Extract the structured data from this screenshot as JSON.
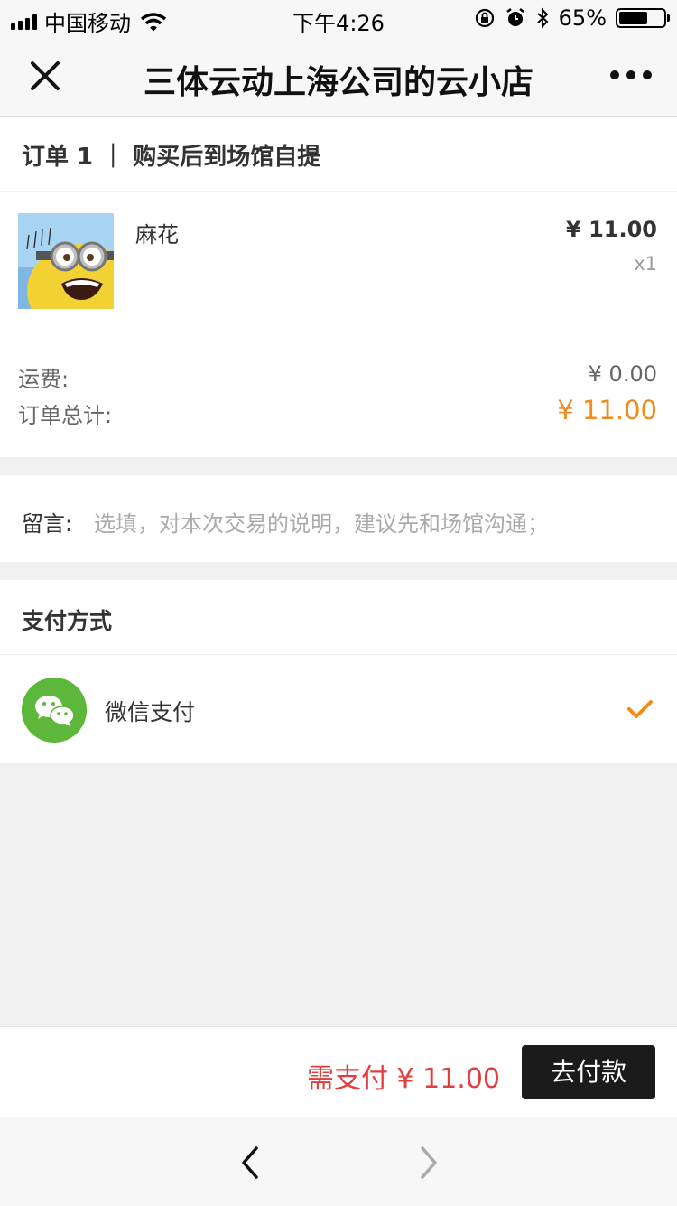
{
  "status_bar": {
    "carrier": "中国移动",
    "time": "下午4:26",
    "battery_percent": "65%",
    "battery_level": 0.65
  },
  "nav": {
    "title": "三体云动上海公司的云小店"
  },
  "order": {
    "header": "订单 1 ｜ 购买后到场馆自提",
    "product": {
      "name": "麻花",
      "price": "¥ 11.00",
      "quantity": "x1"
    },
    "shipping_label": "运费:",
    "shipping_value": "¥ 0.00",
    "total_label": "订单总计:",
    "total_value": "¥ 11.00"
  },
  "message": {
    "label": "留言:",
    "placeholder": "选填，对本次交易的说明，建议先和场馆沟通；"
  },
  "payment": {
    "header": "支付方式",
    "method": "微信支付"
  },
  "bottom": {
    "amount_due": "需支付 ¥ 11.00",
    "pay_button": "去付款"
  },
  "colors": {
    "accent_orange": "#f08c1e",
    "due_red": "#e43d3d",
    "wechat_green": "#5cb73a",
    "button_dark": "#1b1b1b"
  }
}
